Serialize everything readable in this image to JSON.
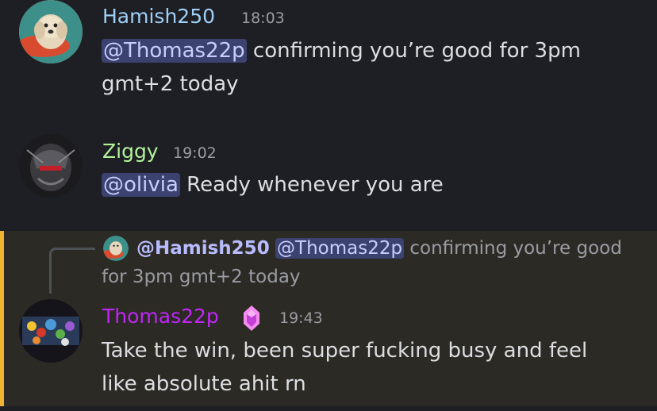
{
  "messages": [
    {
      "username": "Hamish250",
      "username_color": "#9ed0f7",
      "time": "18:03",
      "mention": "@Thomas22p",
      "text_line1": " confirming you’re good for 3pm",
      "text_line2": "gmt+2 today",
      "avatar": "dog-avatar"
    },
    {
      "username": "Ziggy",
      "username_color": "#b2f39a",
      "time": "19:02",
      "mention": "@olivia",
      "text": " Ready whenever you are",
      "avatar": "robot-avatar"
    },
    {
      "reply": {
        "user": "@Hamish250",
        "mention": "@Thomas22p",
        "text": " confirming you’re good for 3pm gmt+2 today"
      },
      "username": "Thomas22p",
      "username_color": "#c026f5",
      "badge": "nitro-gem-icon",
      "time": "19:43",
      "text_line1": "Take the win, been super fucking busy and feel",
      "text_line2": "like absolute ahit rn",
      "avatar": "pokemon-avatar",
      "highlight_color": "#f0b232"
    }
  ]
}
